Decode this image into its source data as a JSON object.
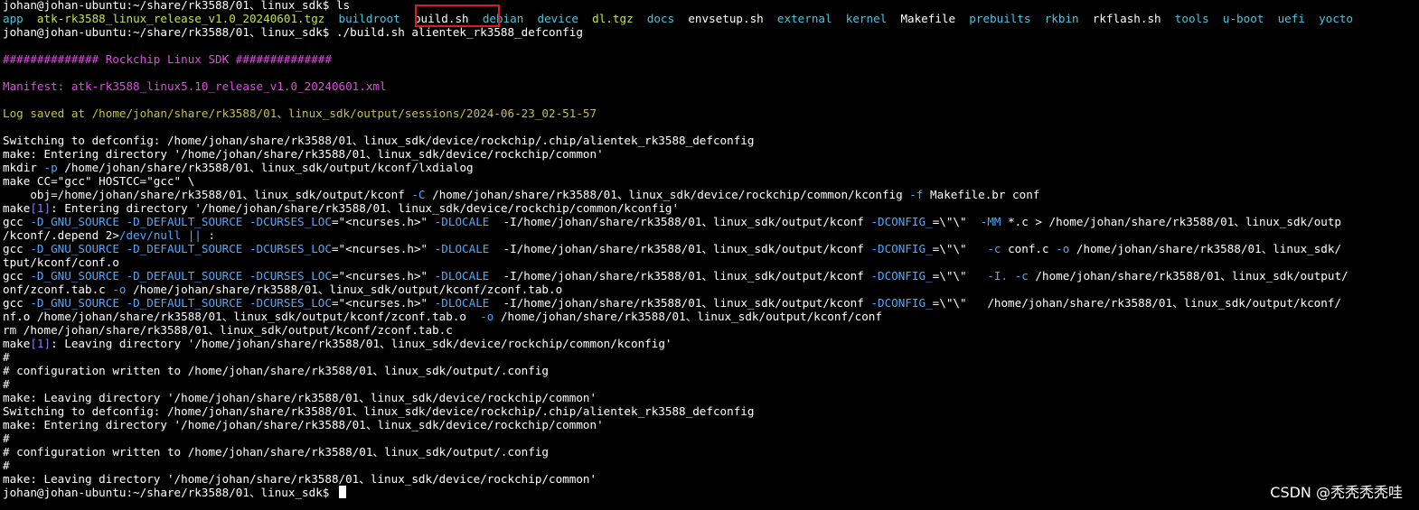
{
  "colors": {
    "default": "#ffffff",
    "cyan": "#4fc3dc",
    "teal": "#3fd3c6",
    "yellowgreen": "#c8e04a",
    "magenta": "#e04ae0",
    "olive": "#c8c040",
    "flag": "#4fa8ff",
    "purple": "#a070f0",
    "highlight_box": "#e0191e"
  },
  "terminal": {
    "lines": [
      [
        {
          "t": "johan@johan-ubuntu:~/share/rk3588/01、linux_sdk$ ls",
          "c": "default"
        }
      ],
      [
        {
          "t": "app",
          "c": "cyan"
        },
        {
          "t": "  ",
          "c": "default"
        },
        {
          "t": "atk-rk3588_linux_release_v1.0_20240601.tgz",
          "c": "yellowgreen"
        },
        {
          "t": "  ",
          "c": "default"
        },
        {
          "t": "buildroot",
          "c": "cyan"
        },
        {
          "t": "  ",
          "c": "default"
        },
        {
          "t": "build.sh",
          "c": "default"
        },
        {
          "t": "  ",
          "c": "default"
        },
        {
          "t": "debian",
          "c": "cyan"
        },
        {
          "t": "  ",
          "c": "default"
        },
        {
          "t": "device",
          "c": "cyan"
        },
        {
          "t": "  ",
          "c": "default"
        },
        {
          "t": "dl.tgz",
          "c": "yellowgreen"
        },
        {
          "t": "  ",
          "c": "default"
        },
        {
          "t": "docs",
          "c": "cyan"
        },
        {
          "t": "  ",
          "c": "default"
        },
        {
          "t": "envsetup.sh",
          "c": "default"
        },
        {
          "t": "  ",
          "c": "default"
        },
        {
          "t": "external",
          "c": "cyan"
        },
        {
          "t": "  ",
          "c": "default"
        },
        {
          "t": "kernel",
          "c": "cyan"
        },
        {
          "t": "  ",
          "c": "default"
        },
        {
          "t": "Makefile",
          "c": "default"
        },
        {
          "t": "  ",
          "c": "default"
        },
        {
          "t": "prebuilts",
          "c": "cyan"
        },
        {
          "t": "  ",
          "c": "default"
        },
        {
          "t": "rkbin",
          "c": "cyan"
        },
        {
          "t": "  ",
          "c": "default"
        },
        {
          "t": "rkflash.sh",
          "c": "default"
        },
        {
          "t": "  ",
          "c": "default"
        },
        {
          "t": "tools",
          "c": "cyan"
        },
        {
          "t": "  ",
          "c": "default"
        },
        {
          "t": "u-boot",
          "c": "cyan"
        },
        {
          "t": "  ",
          "c": "default"
        },
        {
          "t": "uefi",
          "c": "cyan"
        },
        {
          "t": "  ",
          "c": "default"
        },
        {
          "t": "yocto",
          "c": "cyan"
        }
      ],
      [
        {
          "t": "johan@johan-ubuntu:~/share/rk3588/01、linux_sdk$ ./build.sh alientek_rk3588_defconfig",
          "c": "default"
        }
      ],
      [
        {
          "t": "",
          "c": "default"
        }
      ],
      [
        {
          "t": "############## Rockchip Linux SDK ##############",
          "c": "magenta"
        }
      ],
      [
        {
          "t": "",
          "c": "default"
        }
      ],
      [
        {
          "t": "Manifest: atk-rk3588_linux5.10_release_v1.0_20240601.xml",
          "c": "magenta"
        }
      ],
      [
        {
          "t": "",
          "c": "default"
        }
      ],
      [
        {
          "t": "Log saved at /home/johan/share/rk3588/01、linux_sdk/output/sessions/2024-06-23_02-51-57",
          "c": "olive"
        }
      ],
      [
        {
          "t": "",
          "c": "default"
        }
      ],
      [
        {
          "t": "Switching to defconfig: /home/johan/share/rk3588/01、linux_sdk/device/rockchip/.chip/alientek_rk3588_defconfig",
          "c": "default"
        }
      ],
      [
        {
          "t": "make: Entering directory '/home/johan/share/rk3588/01、linux_sdk/device/rockchip/common'",
          "c": "default"
        }
      ],
      [
        {
          "t": "mkdir ",
          "c": "default"
        },
        {
          "t": "-p",
          "c": "flag"
        },
        {
          "t": " /home/johan/share/rk3588/01、linux_sdk/output/kconf/lxdialog",
          "c": "default"
        }
      ],
      [
        {
          "t": "make CC=\"gcc\" HOSTCC=\"gcc\" \\",
          "c": "default"
        }
      ],
      [
        {
          "t": "    obj=/home/johan/share/rk3588/01、linux_sdk/output/kconf ",
          "c": "default"
        },
        {
          "t": "-C",
          "c": "flag"
        },
        {
          "t": " /home/johan/share/rk3588/01、linux_sdk/device/rockchip/common/kconfig ",
          "c": "default"
        },
        {
          "t": "-f",
          "c": "flag"
        },
        {
          "t": " Makefile.br conf",
          "c": "default"
        }
      ],
      [
        {
          "t": "make",
          "c": "default"
        },
        {
          "t": "[1]",
          "c": "purple"
        },
        {
          "t": ": Entering directory '/home/johan/share/rk3588/01、linux_sdk/device/rockchip/common/kconfig'",
          "c": "default"
        }
      ],
      [
        {
          "t": "gcc ",
          "c": "default"
        },
        {
          "t": "-D_GNU_SOURCE -D_DEFAULT_SOURCE -DCURSES_LOC",
          "c": "flag"
        },
        {
          "t": "=\"<ncurses.h>\" ",
          "c": "default"
        },
        {
          "t": "-DLOCALE",
          "c": "flag"
        },
        {
          "t": "  -I/home/johan/share/rk3588/01、linux_sdk/output/kconf ",
          "c": "default"
        },
        {
          "t": "-DCONFIG_",
          "c": "flag"
        },
        {
          "t": "=\\\"\\\"  ",
          "c": "default"
        },
        {
          "t": "-MM",
          "c": "flag"
        },
        {
          "t": " *.c > /home/johan/share/rk3588/01、linux_sdk/outp",
          "c": "default"
        }
      ],
      [
        {
          "t": "/kconf/.depend 2>",
          "c": "default"
        },
        {
          "t": "/dev/null ||",
          "c": "flag"
        },
        {
          "t": " :",
          "c": "default"
        }
      ],
      [
        {
          "t": "gcc ",
          "c": "default"
        },
        {
          "t": "-D_GNU_SOURCE -D_DEFAULT_SOURCE -DCURSES_LOC",
          "c": "flag"
        },
        {
          "t": "=\"<ncurses.h>\" ",
          "c": "default"
        },
        {
          "t": "-DLOCALE",
          "c": "flag"
        },
        {
          "t": "  -I/home/johan/share/rk3588/01、linux_sdk/output/kconf ",
          "c": "default"
        },
        {
          "t": "-DCONFIG_",
          "c": "flag"
        },
        {
          "t": "=\\\"\\\"   ",
          "c": "default"
        },
        {
          "t": "-c",
          "c": "flag"
        },
        {
          "t": " conf.c ",
          "c": "default"
        },
        {
          "t": "-o",
          "c": "flag"
        },
        {
          "t": " /home/johan/share/rk3588/01、linux_sdk/",
          "c": "default"
        }
      ],
      [
        {
          "t": "tput/kconf/conf.o",
          "c": "default"
        }
      ],
      [
        {
          "t": "gcc ",
          "c": "default"
        },
        {
          "t": "-D_GNU_SOURCE -D_DEFAULT_SOURCE -DCURSES_LOC",
          "c": "flag"
        },
        {
          "t": "=\"<ncurses.h>\" ",
          "c": "default"
        },
        {
          "t": "-DLOCALE",
          "c": "flag"
        },
        {
          "t": "  -I/home/johan/share/rk3588/01、linux_sdk/output/kconf ",
          "c": "default"
        },
        {
          "t": "-DCONFIG_",
          "c": "flag"
        },
        {
          "t": "=\\\"\\\"   ",
          "c": "default"
        },
        {
          "t": "-I.",
          "c": "flag"
        },
        {
          "t": " ",
          "c": "default"
        },
        {
          "t": "-c",
          "c": "flag"
        },
        {
          "t": " /home/johan/share/rk3588/01、linux_sdk/output/",
          "c": "default"
        }
      ],
      [
        {
          "t": "onf/zconf.tab.c ",
          "c": "default"
        },
        {
          "t": "-o",
          "c": "flag"
        },
        {
          "t": " /home/johan/share/rk3588/01、linux_sdk/output/kconf/zconf.tab.o",
          "c": "default"
        }
      ],
      [
        {
          "t": "gcc ",
          "c": "default"
        },
        {
          "t": "-D_GNU_SOURCE -D_DEFAULT_SOURCE -DCURSES_LOC",
          "c": "flag"
        },
        {
          "t": "=\"<ncurses.h>\" ",
          "c": "default"
        },
        {
          "t": "-DLOCALE",
          "c": "flag"
        },
        {
          "t": "  -I/home/johan/share/rk3588/01、linux_sdk/output/kconf ",
          "c": "default"
        },
        {
          "t": "-DCONFIG_",
          "c": "flag"
        },
        {
          "t": "=\\\"\\\"   /home/johan/share/rk3588/01、linux_sdk/output/kconf/",
          "c": "default"
        }
      ],
      [
        {
          "t": "nf.o /home/johan/share/rk3588/01、linux_sdk/output/kconf/zconf.tab.o  ",
          "c": "default"
        },
        {
          "t": "-o",
          "c": "flag"
        },
        {
          "t": " /home/johan/share/rk3588/01、linux_sdk/output/kconf/conf",
          "c": "default"
        }
      ],
      [
        {
          "t": "rm /home/johan/share/rk3588/01、linux_sdk/output/kconf/zconf.tab.c",
          "c": "default"
        }
      ],
      [
        {
          "t": "make",
          "c": "default"
        },
        {
          "t": "[1]",
          "c": "purple"
        },
        {
          "t": ": Leaving directory '/home/johan/share/rk3588/01、linux_sdk/device/rockchip/common/kconfig'",
          "c": "default"
        }
      ],
      [
        {
          "t": "#",
          "c": "default"
        }
      ],
      [
        {
          "t": "# configuration written to /home/johan/share/rk3588/01、linux_sdk/output/.config",
          "c": "default"
        }
      ],
      [
        {
          "t": "#",
          "c": "default"
        }
      ],
      [
        {
          "t": "make: Leaving directory '/home/johan/share/rk3588/01、linux_sdk/device/rockchip/common'",
          "c": "default"
        }
      ],
      [
        {
          "t": "Switching to defconfig: /home/johan/share/rk3588/01、linux_sdk/device/rockchip/.chip/alientek_rk3588_defconfig",
          "c": "default"
        }
      ],
      [
        {
          "t": "make: Entering directory '/home/johan/share/rk3588/01、linux_sdk/device/rockchip/common'",
          "c": "default"
        }
      ],
      [
        {
          "t": "#",
          "c": "default"
        }
      ],
      [
        {
          "t": "# configuration written to /home/johan/share/rk3588/01、linux_sdk/output/.config",
          "c": "default"
        }
      ],
      [
        {
          "t": "#",
          "c": "default"
        }
      ],
      [
        {
          "t": "make: Leaving directory '/home/johan/share/rk3588/01、linux_sdk/device/rockchip/common'",
          "c": "default"
        }
      ],
      [
        {
          "t": "johan@johan-ubuntu:~/share/rk3588/01、linux_sdk$ ",
          "c": "default"
        }
      ]
    ]
  },
  "watermark": "CSDN @秃秃秃秃哇"
}
